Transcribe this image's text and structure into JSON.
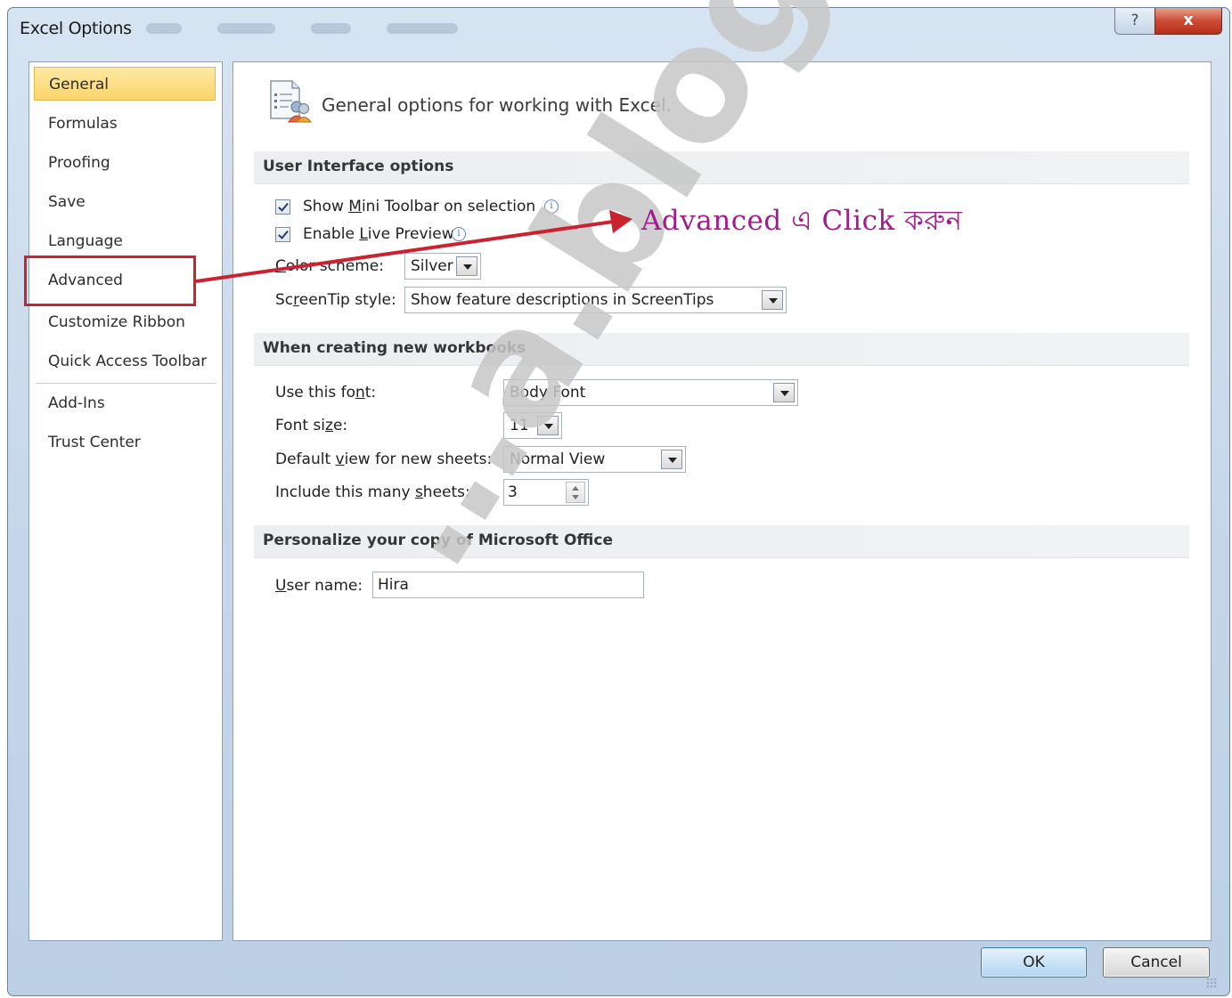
{
  "window": {
    "title": "Excel Options",
    "help_label": "?",
    "close_label": "x"
  },
  "sidebar": {
    "items": [
      {
        "label": "General",
        "active": true
      },
      {
        "label": "Formulas"
      },
      {
        "label": "Proofing"
      },
      {
        "label": "Save"
      },
      {
        "label": "Language"
      },
      {
        "label": "Advanced"
      },
      {
        "label": "Customize Ribbon"
      },
      {
        "label": "Quick Access Toolbar"
      },
      {
        "label": "Add-Ins"
      },
      {
        "label": "Trust Center"
      }
    ]
  },
  "main": {
    "header": "General options for working with Excel.",
    "sections": {
      "ui": "User Interface options",
      "new_workbooks": "When creating new workbooks",
      "personalize": "Personalize your copy of Microsoft Office"
    },
    "ui_options": {
      "mini_toolbar": {
        "label": "Show Mini Toolbar on selection",
        "checked": true
      },
      "live_preview": {
        "label": "Enable Live Preview",
        "checked": true
      },
      "color_scheme": {
        "label": "Color scheme:",
        "value": "Silver"
      },
      "screentip": {
        "label": "ScreenTip style:",
        "value": "Show feature descriptions in ScreenTips"
      }
    },
    "new_workbooks": {
      "font": {
        "label": "Use this font:",
        "value": "Body Font"
      },
      "font_size": {
        "label": "Font size:",
        "value": "11"
      },
      "default_view": {
        "label": "Default view for new sheets:",
        "value": "Normal View"
      },
      "sheets": {
        "label": "Include this many sheets:",
        "value": "3"
      }
    },
    "personalize": {
      "user_name": {
        "label": "User name:",
        "value": "Hira"
      }
    }
  },
  "footer": {
    "ok": "OK",
    "cancel": "Cancel"
  },
  "annotation": {
    "text": "Advanced এ Click করুন",
    "color": "#a21b8f",
    "box_color": "#c9232f"
  },
  "watermark": {
    "text": "…a.blogspot.com"
  }
}
